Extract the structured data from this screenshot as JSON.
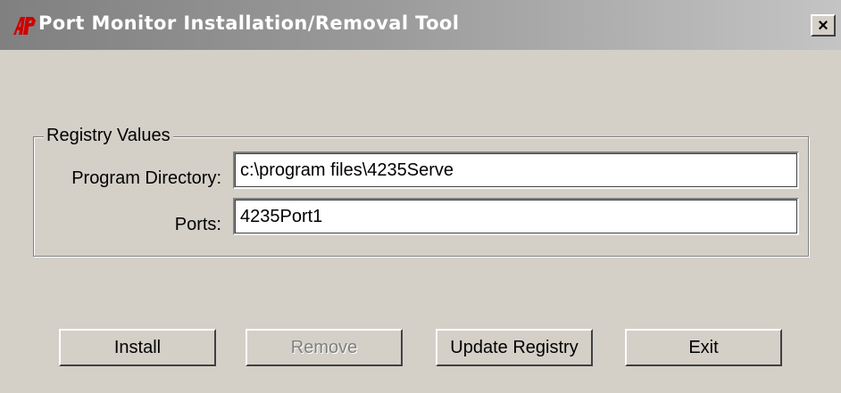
{
  "window": {
    "title": "Port Monitor Installation/Removal Tool",
    "close_glyph": "×"
  },
  "group": {
    "legend": "Registry Values",
    "program_directory": {
      "label": "Program Directory:",
      "value": "c:\\program files\\4235Serve"
    },
    "ports": {
      "label": "Ports:",
      "value": "4235Port1"
    }
  },
  "buttons": {
    "install": "Install",
    "remove": "Remove",
    "update_registry": "Update Registry",
    "exit": "Exit"
  },
  "icons": {
    "app": "ap-logo-icon",
    "close": "close-icon"
  },
  "colors": {
    "titlebar": "#808080",
    "face": "#d4d0c8",
    "logo": "#d00000"
  }
}
